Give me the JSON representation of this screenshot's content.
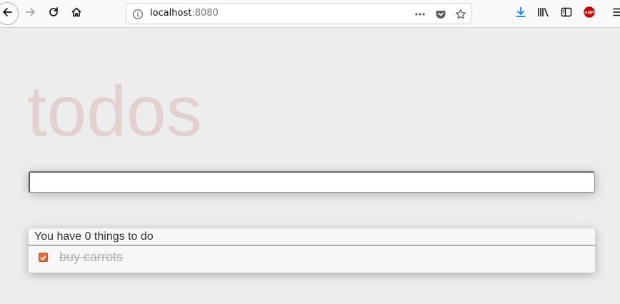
{
  "browser": {
    "url_host": "localhost",
    "url_port": ":8080",
    "icons": {
      "back": "back-arrow-icon",
      "forward": "forward-arrow-icon",
      "reload": "reload-icon",
      "home": "home-icon",
      "info": "info-icon",
      "page_actions": "more-dots-icon",
      "pocket": "pocket-icon",
      "bookmark": "star-icon",
      "downloads": "download-icon",
      "library": "library-icon",
      "sidebar": "sidebar-icon",
      "adblock": "adblock-icon",
      "menu": "hamburger-menu-icon"
    },
    "adblock_label": "ABP"
  },
  "app": {
    "title": "todos",
    "new_todo_value": "",
    "count_text": "You have 0 things to do",
    "todos": [
      {
        "label": "buy carrots",
        "completed": true
      }
    ]
  },
  "colors": {
    "title": "#e8d4d4",
    "checkbox": "#d9704a",
    "completed_text": "#b0b0b0",
    "download_icon": "#0a84ff",
    "adblock": "#c80000"
  }
}
